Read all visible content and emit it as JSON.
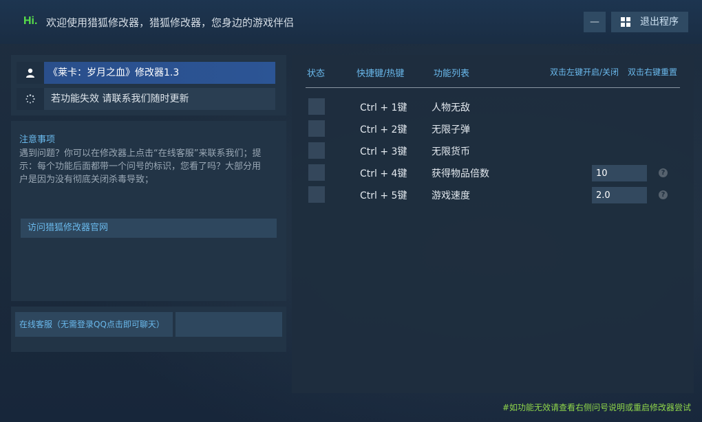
{
  "header": {
    "hi": "Hi.",
    "welcome": "欢迎使用猎狐修改器，猎狐修改器，您身边的游戏伴侣",
    "minimize_label": "—",
    "exit_label": "退出程序"
  },
  "game": {
    "title": "《莱卡：岁月之血》修改器1.3",
    "notice": "若功能失效  请联系我们随时更新"
  },
  "notes": {
    "title": "注意事项",
    "body": "遇到问题？你可以在修改器上点击“在线客服”来联系我们；提示：每个功能后面都带一个问号的标识，您看了吗？大部分用户是因为没有彻底关闭杀毒导致；",
    "visit_label": "访问猎狐修改器官网"
  },
  "support": {
    "chat_label": "在线客服（无需登录QQ点击即可聊天）"
  },
  "table": {
    "headers": {
      "status": "状态",
      "hotkey": "快捷键/热键",
      "feature": "功能列表",
      "left_click": "双击左键开启/关闭",
      "right_click": "双击右键重置"
    },
    "rows": [
      {
        "hotkey": "Ctrl  +  1键",
        "feature": "人物无敌"
      },
      {
        "hotkey": "Ctrl  +  2键",
        "feature": "无限子弹"
      },
      {
        "hotkey": "Ctrl  +  3键",
        "feature": "无限货币"
      },
      {
        "hotkey": "Ctrl  +  4键",
        "feature": "获得物品倍数",
        "value": "10",
        "help": "?"
      },
      {
        "hotkey": "Ctrl  +  5键",
        "feature": "游戏速度",
        "value": "2.0",
        "help": "?"
      }
    ]
  },
  "footer": {
    "tip": "#如功能无效请查看右侧问号说明或重启修改器尝试"
  }
}
